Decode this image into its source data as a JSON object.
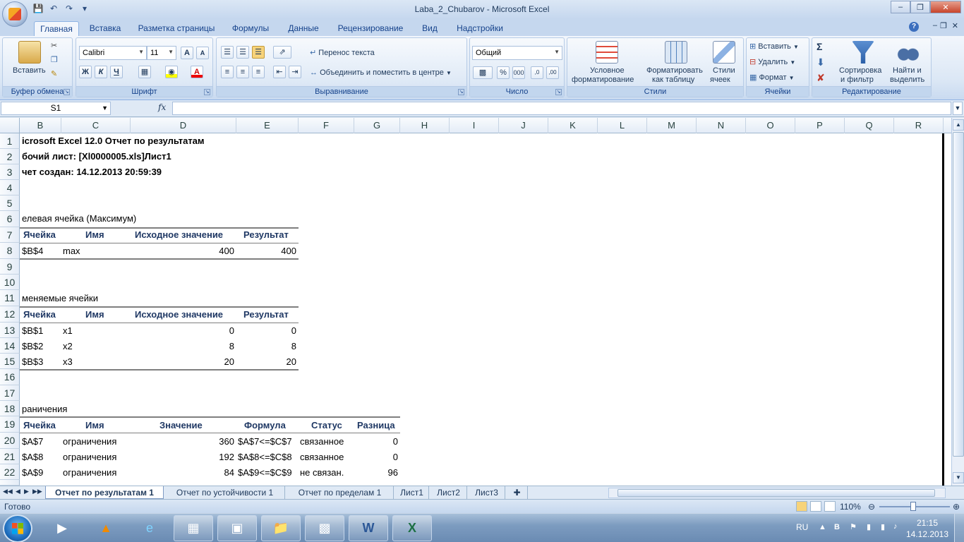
{
  "window": {
    "title": "Laba_2_Chubarov - Microsoft Excel"
  },
  "ribbon_tabs": [
    "Главная",
    "Вставка",
    "Разметка страницы",
    "Формулы",
    "Данные",
    "Рецензирование",
    "Вид",
    "Надстройки"
  ],
  "ribbon": {
    "clipboard": {
      "paste": "Вставить",
      "label": "Буфер обмена"
    },
    "font": {
      "name": "Calibri",
      "size": "11",
      "bold": "Ж",
      "italic": "К",
      "underline": "Ч",
      "label": "Шрифт"
    },
    "alignment": {
      "wrap": "Перенос текста",
      "merge": "Объединить и поместить в центре",
      "label": "Выравнивание"
    },
    "number": {
      "format": "Общий",
      "label": "Число"
    },
    "styles": {
      "conditional_1": "Условное",
      "conditional_2": "форматирование",
      "astable_1": "Форматировать",
      "astable_2": "как таблицу",
      "cellstyles_1": "Стили",
      "cellstyles_2": "ячеек",
      "label": "Стили"
    },
    "cells": {
      "insert": "Вставить",
      "delete": "Удалить",
      "format": "Формат",
      "label": "Ячейки"
    },
    "editing": {
      "sort_1": "Сортировка",
      "sort_2": "и фильтр",
      "find_1": "Найти и",
      "find_2": "выделить",
      "label": "Редактирование"
    }
  },
  "formula_bar": {
    "name_box": "S1",
    "fx": "fx",
    "formula": ""
  },
  "columns": [
    "B",
    "C",
    "D",
    "E",
    "F",
    "G",
    "H",
    "I",
    "J",
    "K",
    "L",
    "M",
    "N",
    "O",
    "P",
    "Q",
    "R"
  ],
  "rows": [
    "1",
    "2",
    "3",
    "4",
    "5",
    "6",
    "7",
    "8",
    "9",
    "10",
    "11",
    "12",
    "13",
    "14",
    "15",
    "16",
    "17",
    "18",
    "19",
    "20",
    "21",
    "22"
  ],
  "sheet": {
    "r1": "icrosoft Excel 12.0 Отчет по результатам",
    "r2": "бочий лист: [Xl0000005.xls]Лист1",
    "r3": "чет создан: 14.12.2013 20:59:39",
    "r6": "елевая ячейка (Максимум)",
    "target_headers": [
      "Ячейка",
      "Имя",
      "Исходное значение",
      "Результат"
    ],
    "target_row": [
      "$B$4",
      "max",
      "400",
      "400"
    ],
    "r11": "меняемые ячейки",
    "var_headers": [
      "Ячейка",
      "Имя",
      "Исходное значение",
      "Результат"
    ],
    "var_rows": [
      [
        "$B$1",
        "x1",
        "0",
        "0"
      ],
      [
        "$B$2",
        "x2",
        "8",
        "8"
      ],
      [
        "$B$3",
        "x3",
        "20",
        "20"
      ]
    ],
    "r18": "раничения",
    "con_headers": [
      "Ячейка",
      "Имя",
      "Значение",
      "Формула",
      "Статус",
      "Разница"
    ],
    "con_rows": [
      [
        "$A$7",
        "ограничения",
        "360",
        "$A$7<=$C$7",
        "связанное",
        "0"
      ],
      [
        "$A$8",
        "ограничения",
        "192",
        "$A$8<=$C$8",
        "связанное",
        "0"
      ],
      [
        "$A$9",
        "ограничения",
        "84",
        "$A$9<=$C$9",
        "не связан.",
        "96"
      ]
    ]
  },
  "sheet_tabs": [
    "Отчет по результатам 1",
    "Отчет по устойчивости 1",
    "Отчет по пределам 1",
    "Лист1",
    "Лист2",
    "Лист3"
  ],
  "status": {
    "ready": "Готово",
    "zoom": "110%"
  },
  "taskbar": {
    "lang": "RU",
    "time": "21:15",
    "date": "14.12.2013"
  }
}
